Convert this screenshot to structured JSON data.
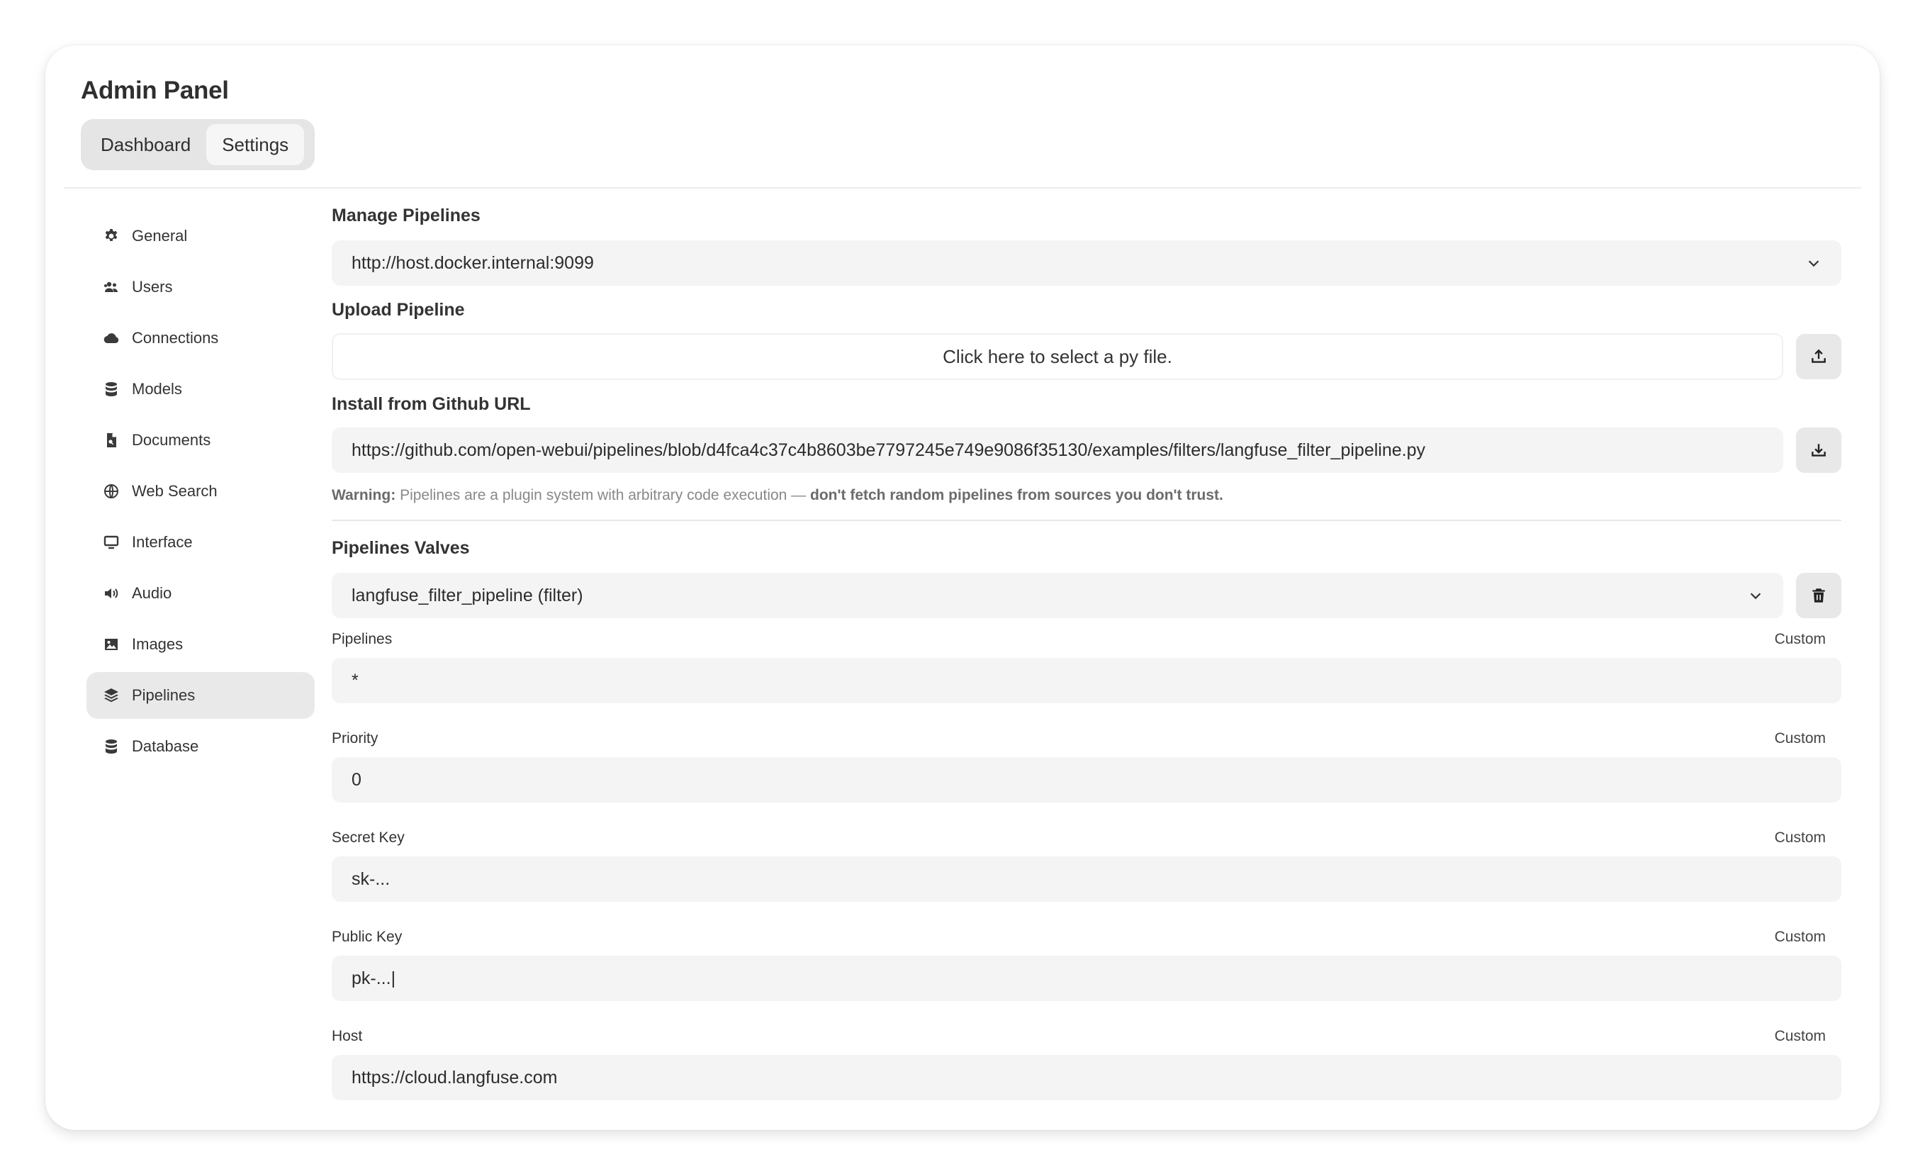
{
  "panel": {
    "title": "Admin Panel"
  },
  "tabs": [
    {
      "label": "Dashboard",
      "active": false
    },
    {
      "label": "Settings",
      "active": true
    }
  ],
  "sidebar": {
    "items": [
      {
        "label": "General",
        "icon": "gear-icon"
      },
      {
        "label": "Users",
        "icon": "users-icon"
      },
      {
        "label": "Connections",
        "icon": "cloud-icon"
      },
      {
        "label": "Models",
        "icon": "database-icon"
      },
      {
        "label": "Documents",
        "icon": "document-icon"
      },
      {
        "label": "Web Search",
        "icon": "globe-icon"
      },
      {
        "label": "Interface",
        "icon": "monitor-icon"
      },
      {
        "label": "Audio",
        "icon": "speaker-icon"
      },
      {
        "label": "Images",
        "icon": "image-icon"
      },
      {
        "label": "Pipelines",
        "icon": "layers-icon",
        "active": true
      },
      {
        "label": "Database",
        "icon": "database-icon"
      }
    ]
  },
  "manage": {
    "title": "Manage Pipelines",
    "selected_url": "http://host.docker.internal:9099"
  },
  "upload": {
    "title": "Upload Pipeline",
    "prompt": "Click here to select a py file."
  },
  "github": {
    "title": "Install from Github URL",
    "url": "https://github.com/open-webui/pipelines/blob/d4fca4c37c4b8603be7797245e749e9086f35130/examples/filters/langfuse_filter_pipeline.py"
  },
  "warning": {
    "label": "Warning:",
    "text_start": "Pipelines are a plugin system with arbitrary code execution — ",
    "text_bold": "don't fetch random pipelines from sources you don't trust."
  },
  "valves": {
    "title": "Pipelines Valves",
    "selected_pipeline": "langfuse_filter_pipeline (filter)",
    "custom_label": "Custom",
    "fields": [
      {
        "label": "Pipelines",
        "value": "*"
      },
      {
        "label": "Priority",
        "value": "0"
      },
      {
        "label": "Secret Key",
        "value": "sk-..."
      },
      {
        "label": "Public Key",
        "value": "pk-...|"
      },
      {
        "label": "Host",
        "value": "https://cloud.langfuse.com"
      }
    ]
  }
}
